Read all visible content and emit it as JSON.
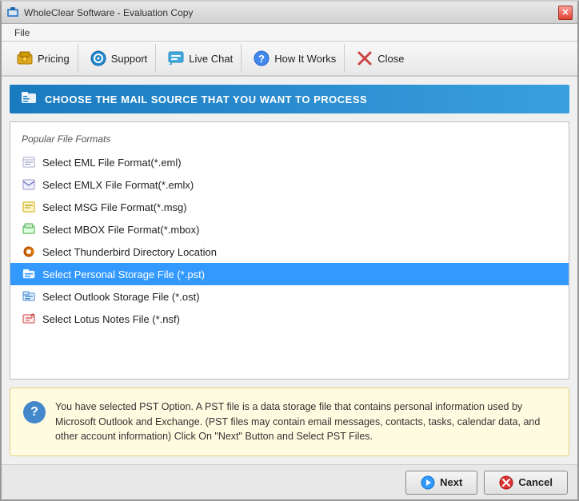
{
  "window": {
    "title": "WholeClear Software - Evaluation Copy",
    "icon": "💾"
  },
  "menu": {
    "items": [
      {
        "label": "File"
      }
    ]
  },
  "toolbar": {
    "buttons": [
      {
        "id": "pricing",
        "icon": "🛒",
        "label": "Pricing"
      },
      {
        "id": "support",
        "icon": "🔵",
        "label": "Support"
      },
      {
        "id": "livechat",
        "icon": "💬",
        "label": "Live Chat"
      },
      {
        "id": "howitworks",
        "icon": "❓",
        "label": "How It Works"
      },
      {
        "id": "close",
        "icon": "✖",
        "label": "Close"
      }
    ]
  },
  "section": {
    "header": "CHOOSE THE MAIL SOURCE THAT YOU WANT TO PROCESS",
    "icon": "📁"
  },
  "fileList": {
    "groupLabel": "Popular File Formats",
    "items": [
      {
        "id": "eml",
        "icon": "📄",
        "label": "Select EML File Format(*.eml)",
        "selected": false
      },
      {
        "id": "emlx",
        "icon": "✉",
        "label": "Select EMLX File Format(*.emlx)",
        "selected": false
      },
      {
        "id": "msg",
        "icon": "📨",
        "label": "Select MSG File Format(*.msg)",
        "selected": false
      },
      {
        "id": "mbox",
        "icon": "📦",
        "label": "Select MBOX File Format(*.mbox)",
        "selected": false
      },
      {
        "id": "thunderbird",
        "icon": "🌀",
        "label": "Select Thunderbird Directory Location",
        "selected": false
      },
      {
        "id": "pst",
        "icon": "📁",
        "label": "Select Personal Storage File (*.pst)",
        "selected": true
      },
      {
        "id": "ost",
        "icon": "📁",
        "label": "Select Outlook Storage File (*.ost)",
        "selected": false
      },
      {
        "id": "nsf",
        "icon": "🗒",
        "label": "Select Lotus Notes File (*.nsf)",
        "selected": false
      }
    ]
  },
  "infoBox": {
    "text": "You have selected PST Option. A PST file is a data storage file that contains personal information used by Microsoft Outlook and Exchange. (PST files may contain email messages, contacts, tasks, calendar data, and other account information) Click On \"Next\" Button and Select PST Files."
  },
  "buttons": {
    "next": "Next",
    "cancel": "Cancel"
  }
}
